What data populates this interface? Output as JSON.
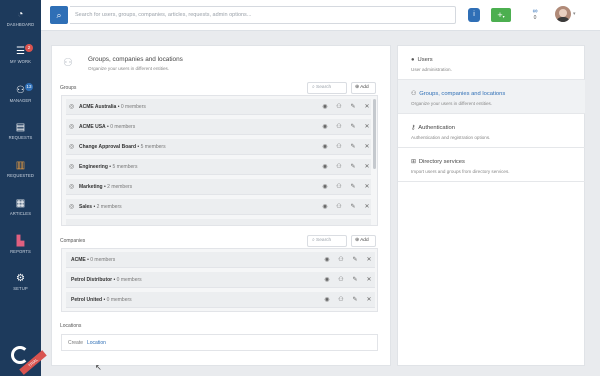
{
  "sidebar": {
    "items": [
      {
        "label": "DASHBOARD",
        "icon": "gauge-icon"
      },
      {
        "label": "MY WORK",
        "icon": "list-icon",
        "badge": "2"
      },
      {
        "label": "MANAGER",
        "icon": "people-icon",
        "badge": "13"
      },
      {
        "label": "REQUESTS",
        "icon": "document-icon"
      },
      {
        "label": "REQUESTED",
        "icon": "file-icon"
      },
      {
        "label": "ARTICLES",
        "icon": "article-icon"
      },
      {
        "label": "REPORTS",
        "icon": "bar-chart-icon"
      },
      {
        "label": "SETUP",
        "icon": "gears-icon"
      }
    ],
    "trial_label": "TRIAL"
  },
  "topbar": {
    "search_placeholder": "Search for users, groups, companies, articles, requests, admin options...",
    "notifications_count": "0",
    "colors": {
      "accent": "#2f6fb6",
      "add": "#4caf50",
      "sidebar": "#1d3a5c",
      "badge": "#d9534f"
    }
  },
  "main": {
    "title": "Groups, companies and locations",
    "subtitle": "Organize your users in different entities.",
    "groups": {
      "label": "Groups",
      "search_placeholder": "Search",
      "add_label": "Add",
      "rows": [
        {
          "name": "ACME Australia",
          "count": "0 members"
        },
        {
          "name": "ACME USA",
          "count": "0 members"
        },
        {
          "name": "Change Approval Board",
          "count": "5 members"
        },
        {
          "name": "Engineering",
          "count": "5 members"
        },
        {
          "name": "Marketing",
          "count": "2 members"
        },
        {
          "name": "Sales",
          "count": "2 members"
        }
      ]
    },
    "companies": {
      "label": "Companies",
      "search_placeholder": "Search",
      "add_label": "Add",
      "rows": [
        {
          "name": "ACME",
          "count": "0 members"
        },
        {
          "name": "Petrol Distributor",
          "count": "0 members"
        },
        {
          "name": "Petrol United",
          "count": "0 members"
        }
      ]
    },
    "locations": {
      "label": "Locations",
      "create_label": "Create",
      "create_link": "Location"
    }
  },
  "settings_menu": [
    {
      "title": "Users",
      "subtitle": "User administration.",
      "icon": "user-icon"
    },
    {
      "title": "Groups, companies and locations",
      "subtitle": "Organize your users in different entities.",
      "icon": "groups-icon",
      "active": true
    },
    {
      "title": "Authentication",
      "subtitle": "Authentication and registration options.",
      "icon": "key-icon"
    },
    {
      "title": "Directory services",
      "subtitle": "Import users and groups from directory services.",
      "icon": "sitemap-icon"
    }
  ]
}
